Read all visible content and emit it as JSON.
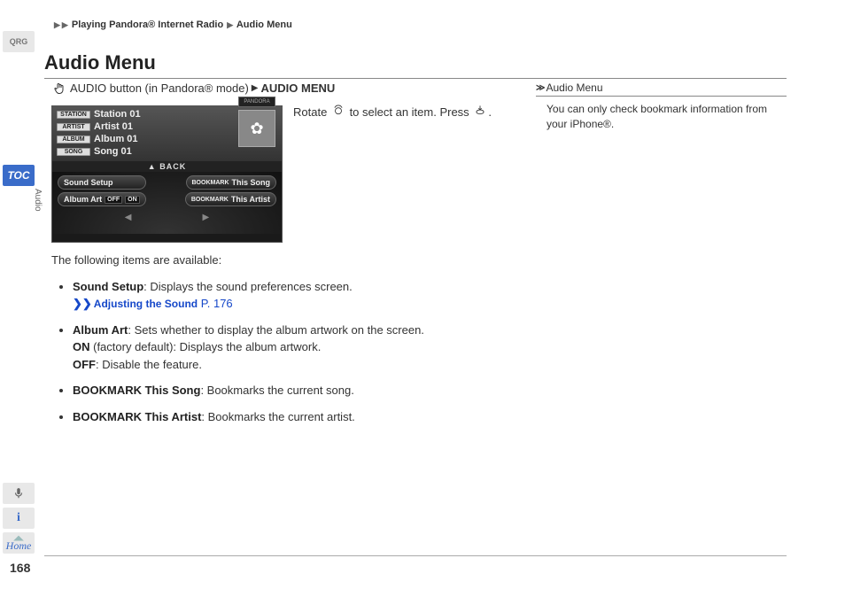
{
  "sidebar": {
    "qrg": "QRG",
    "toc": "TOC",
    "section_label": "Audio",
    "home": "Home"
  },
  "breadcrumb": {
    "seg1": "Playing Pandora® Internet Radio",
    "seg2": "Audio Menu"
  },
  "title": "Audio Menu",
  "instruction": {
    "pre": "AUDIO button (in Pandora® mode)",
    "menu": "AUDIO MENU",
    "rotate_a": "Rotate",
    "rotate_b": "to select an item. Press",
    "rotate_c": "."
  },
  "device": {
    "station_tag": "STATION",
    "station": "Station 01",
    "artist_tag": "ARTIST",
    "artist": "Artist 01",
    "album_tag": "ALBUM",
    "album": "Album 01",
    "song_tag": "SONG",
    "song": "Song 01",
    "logo": "PANDORA",
    "back": "BACK",
    "sound_setup": "Sound Setup",
    "album_art": "Album Art",
    "off": "OFF",
    "on": "ON",
    "bm_song_pre": "BOOKMARK",
    "bm_song": "This Song",
    "bm_artist_pre": "BOOKMARK",
    "bm_artist": "This Artist"
  },
  "body": {
    "intro": "The following items are available:",
    "sound_setup_b": "Sound Setup",
    "sound_setup_t": ": Displays the sound preferences screen.",
    "link_text": "Adjusting the Sound",
    "link_page": "P. 176",
    "album_art_b": "Album Art",
    "album_art_t": ": Sets whether to display the album artwork on the screen.",
    "on_b": "ON",
    "on_t": " (factory default): Displays the album artwork.",
    "off_b": "OFF",
    "off_t": ": Disable the feature.",
    "bm_song_b": "BOOKMARK This Song",
    "bm_song_t": ": Bookmarks the current song.",
    "bm_artist_b": "BOOKMARK This Artist",
    "bm_artist_t": ": Bookmarks the current artist."
  },
  "side_note": {
    "head": "Audio Menu",
    "body": "You can only check bookmark information from your iPhone®."
  },
  "page_number": "168"
}
